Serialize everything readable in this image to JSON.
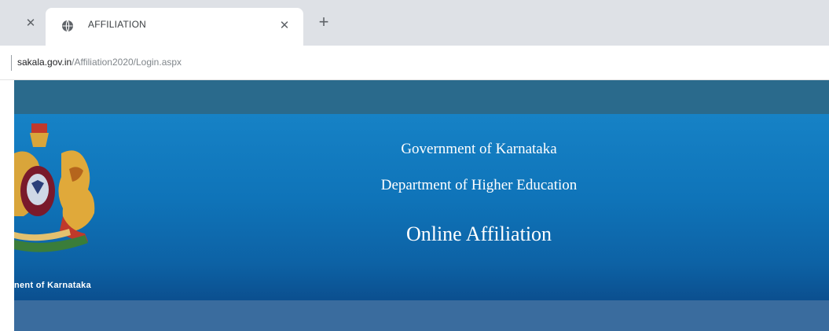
{
  "browser": {
    "prev_tab_close_icon": "close-icon",
    "tab": {
      "title": "AFFILIATION",
      "favicon": "globe-icon",
      "close_icon": "close-icon"
    },
    "new_tab_icon": "plus-icon",
    "url_domain": "sakala.gov.in",
    "url_path": "/Affiliation2020/Login.aspx"
  },
  "banner": {
    "emblem": "karnataka-emblem",
    "emblem_caption": "nent of Karnataka",
    "line1": "Government of Karnataka",
    "line2": "Department of Higher Education",
    "line3": "Online Affiliation"
  },
  "colors": {
    "top_band": "#2a6a8c",
    "banner_top": "#1682c6",
    "banner_bottom": "#0b4f8f",
    "bottom_band": "#3a6c9e"
  }
}
